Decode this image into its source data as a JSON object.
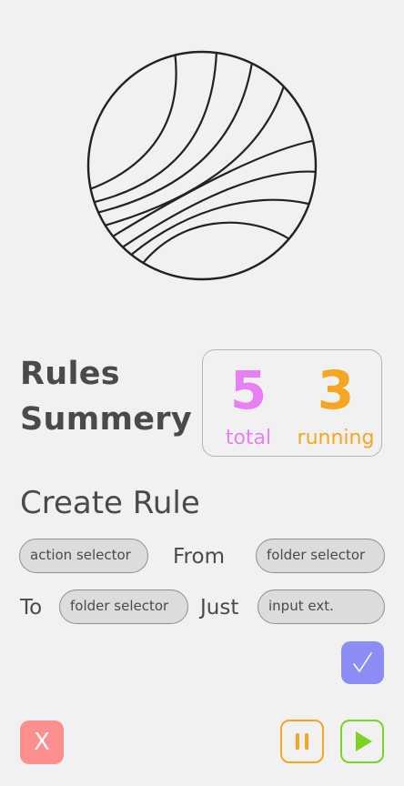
{
  "summary": {
    "title": "Rules Summery",
    "total_count": "5",
    "total_label": "total",
    "running_count": "3",
    "running_label": "running"
  },
  "create_rule": {
    "title": "Create Rule",
    "action_selector": "action selector",
    "from_label": "From",
    "from_folder_selector": "folder selector",
    "to_label": "To",
    "to_folder_selector": "folder selector",
    "just_label": "Just",
    "input_ext": "input ext."
  },
  "controls": {
    "close_label": "X"
  },
  "icons": {
    "logo": "striped-globe-logo",
    "confirm": "checkmark-icon",
    "pause": "pause-icon",
    "play": "play-icon"
  },
  "colors": {
    "background": "#f2f1f1",
    "total": "#e97ff4",
    "running": "#f5a623",
    "confirm": "#8c8cf7",
    "close": "#ff8e8e",
    "pause": "#f5a623",
    "play": "#7ed321"
  }
}
